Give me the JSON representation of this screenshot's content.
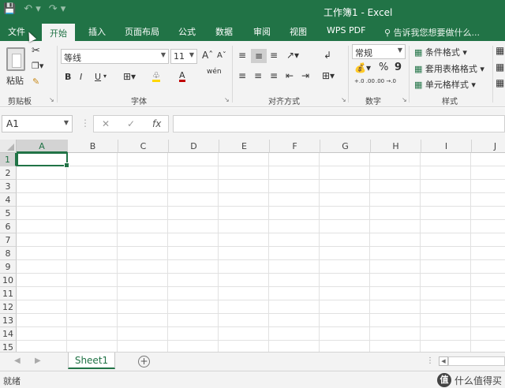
{
  "title": "工作簿1 - Excel",
  "qat": {
    "save_icon": "save-icon",
    "undo_icon": "undo-icon",
    "redo_icon": "redo-icon"
  },
  "tabs": [
    {
      "label": "文件"
    },
    {
      "label": "开始"
    },
    {
      "label": "插入"
    },
    {
      "label": "页面布局"
    },
    {
      "label": "公式"
    },
    {
      "label": "数据"
    },
    {
      "label": "审阅"
    },
    {
      "label": "视图"
    },
    {
      "label": "WPS PDF"
    }
  ],
  "tellme": {
    "icon": "lightbulb-icon",
    "text": "告诉我您想要做什么..."
  },
  "ribbon": {
    "clipboard": {
      "paste": "粘贴",
      "label": "剪贴板"
    },
    "font": {
      "name": "等线",
      "size": "11",
      "grow": "A",
      "shrink": "A",
      "bold": "B",
      "italic": "I",
      "underline": "U",
      "font_color": "A",
      "highlight": "A",
      "wen": "wén",
      "label": "字体"
    },
    "alignment": {
      "label": "对齐方式"
    },
    "number": {
      "format": "常规",
      "percent": "%",
      "comma": "9",
      "label": "数字",
      "inc": "+.0 .00",
      "dec": ".00 →.0"
    },
    "styles": {
      "conditional": "条件格式",
      "table": "套用表格格式",
      "cell": "单元格样式",
      "label": "样式"
    }
  },
  "formula_bar": {
    "name_box": "A1",
    "cancel": "✕",
    "enter": "✓",
    "fx": "fx",
    "value": ""
  },
  "columns": [
    "A",
    "B",
    "C",
    "D",
    "E",
    "F",
    "G",
    "H",
    "I",
    "J"
  ],
  "rows": [
    "1",
    "2",
    "3",
    "4",
    "5",
    "6",
    "7",
    "8",
    "9",
    "10",
    "11",
    "12",
    "13",
    "14",
    "15"
  ],
  "sheets": [
    {
      "name": "Sheet1"
    }
  ],
  "add_sheet": "+",
  "status": "就绪",
  "watermark": {
    "logo": "值",
    "text": "什么值得买"
  },
  "colors": {
    "accent": "#217346",
    "ribbon_bg": "#f3f3f3"
  }
}
